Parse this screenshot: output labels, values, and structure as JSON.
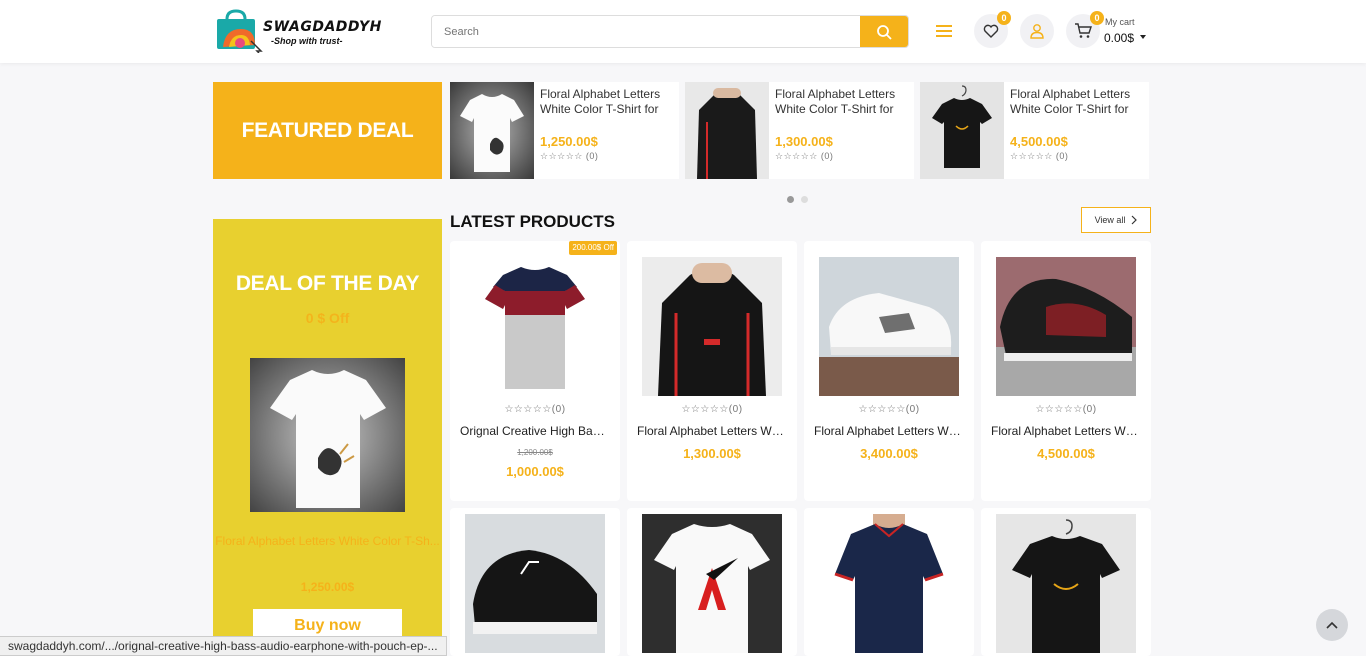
{
  "header": {
    "logo_text": "SWAGDADDYH",
    "logo_tagline": "-Shop with trust-",
    "search_placeholder": "Search",
    "wishlist_count": "0",
    "cart_count": "0",
    "cart_label": "My cart",
    "cart_total": "0.00$"
  },
  "featured": {
    "title": "FEATURED DEAL",
    "items": [
      {
        "name": "Floral Alphabet Letters White Color T-Shirt for",
        "price": "1,250.00$",
        "rating": "(0)"
      },
      {
        "name": "Floral Alphabet Letters White Color T-Shirt for",
        "price": "1,300.00$",
        "rating": "(0)"
      },
      {
        "name": "Floral Alphabet Letters White Color T-Shirt for",
        "price": "4,500.00$",
        "rating": "(0)"
      }
    ]
  },
  "deal_of_day": {
    "title": "DEAL OF THE DAY",
    "off": "0 $ Off",
    "product_name": "Floral Alphabet Letters White Color T-Sh...",
    "price": "1,250.00$",
    "buy_label": "Buy now"
  },
  "latest": {
    "title": "LATEST PRODUCTS",
    "view_all": "View all",
    "products": [
      {
        "name": "Orignal Creative High Bass Audio Earphone",
        "old_price": "1,200.00$",
        "price": "1,000.00$",
        "rating": "(0)",
        "badge": "200.00$ Off"
      },
      {
        "name": "Floral Alphabet Letters White Color",
        "price": "1,300.00$",
        "rating": "(0)"
      },
      {
        "name": "Floral Alphabet Letters White Color",
        "price": "3,400.00$",
        "rating": "(0)"
      },
      {
        "name": "Floral Alphabet Letters White Color",
        "price": "4,500.00$",
        "rating": "(0)"
      }
    ]
  },
  "status_url": "swagdaddyh.com/.../orignal-creative-high-bass-audio-earphone-with-pouch-ep-...",
  "colors": {
    "accent": "#f5b21a",
    "deal_bg": "#e8d02f"
  }
}
